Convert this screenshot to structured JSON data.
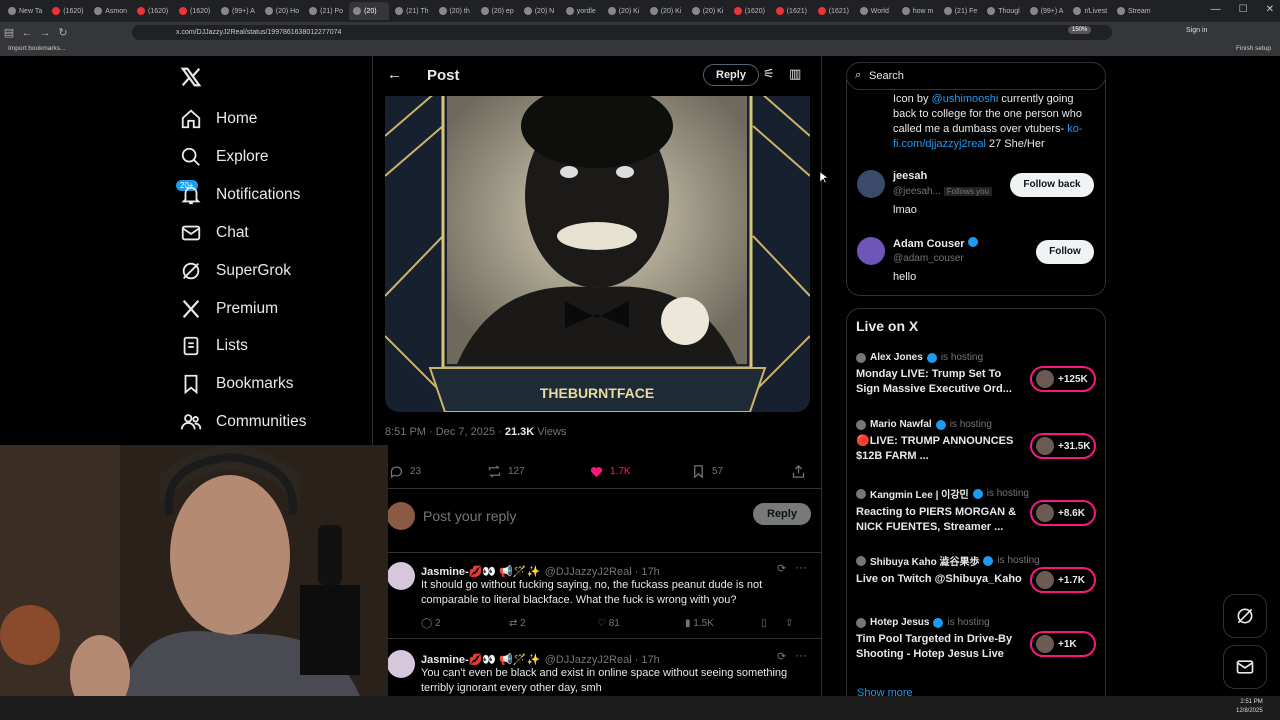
{
  "browser": {
    "tabs": [
      "New Ta",
      "(1620)",
      "Asmon",
      "(1620)",
      "(1620)",
      "(99+) A",
      "(20) Ho",
      "(21) Po",
      "(20)",
      "(21) Th",
      "(20) th",
      "(20) ep",
      "(20) N",
      "yordle",
      "(20) Ki",
      "(20) Ki",
      "(20) Ki",
      "(1620)",
      "(1621)",
      "(1621)",
      "World",
      "how m",
      "(21) Fe",
      "Thougl",
      "(99+) A",
      "r/Livest",
      "Stream"
    ],
    "url": "x.com/DJJazzyJ2Real/status/1997861638012277074",
    "zoom": "150%",
    "bookmarks_label": "Import bookmarks...",
    "sign_in": "Sign in",
    "finish_setup": "Finish setup"
  },
  "nav": {
    "items": [
      "Home",
      "Explore",
      "Notifications",
      "Chat",
      "SuperGrok",
      "Premium",
      "Lists",
      "Bookmarks",
      "Communities"
    ],
    "notif_badge": "20+"
  },
  "post": {
    "header_title": "Post",
    "reply_button": "Reply",
    "image_caption": "THEBURNTFACE",
    "time": "8:51 PM · Dec 7, 2025 ·",
    "views_count": "21.3K",
    "views_label": "Views",
    "replies": "23",
    "reposts": "127",
    "likes": "1.7K",
    "bookmarks": "57",
    "reply_placeholder": "Post your reply",
    "reply_submit": "Reply"
  },
  "replies": [
    {
      "name": "Jasmine-💋👀 📢🪄✨",
      "handle": "@DJJazzyJ2Real · 17h",
      "text": "It should go without fucking saying, no, the fuckass peanut dude is not comparable to literal blackface. What the fuck is wrong with you?",
      "comments": "2",
      "reposts": "2",
      "likes": "81",
      "views": "1.5K"
    },
    {
      "name": "Jasmine-💋👀 📢🪄✨",
      "handle": "@DJJazzyJ2Real · 17h",
      "text": "You can't even be black and exist in online space without seeing something terribly ignorant every other day, smh"
    }
  ],
  "right": {
    "search_placeholder": "Search",
    "bio_parts": [
      "Icon by ",
      "@ushimooshi",
      " currently going back to college for the one person who called me a dumbass over vtubers- ",
      "ko-fi.com/djjazzyj2real",
      " 27 She/Her"
    ],
    "users": [
      {
        "name": "jeesah",
        "handle": "@jeesah...",
        "follows_you": "Follows you",
        "bio": "lmao",
        "button": "Follow back"
      },
      {
        "name": "Adam Couser",
        "handle": "@adam_couser",
        "bio": "hello",
        "button": "Follow"
      }
    ],
    "live_title": "Live on X",
    "live": [
      {
        "host": "Alex Jones",
        "status": "is hosting",
        "title": "Monday LIVE: Trump Set To Sign Massive Executive Ord...",
        "count": "+125K"
      },
      {
        "host": "Mario Nawfal",
        "status": "is hosting",
        "title": "🔴LIVE: TRUMP ANNOUNCES $12B FARM ...",
        "count": "+31.5K"
      },
      {
        "host": "Kangmin Lee | 이강민",
        "status": "is hosting",
        "title": "Reacting to PIERS MORGAN & NICK FUENTES, Streamer ...",
        "count": "+8.6K"
      },
      {
        "host": "Shibuya Kaho 澁谷果歩",
        "status": "is hosting",
        "title": "Live on Twitch @Shibuya_Kaho",
        "count": "+1.7K"
      },
      {
        "host": "Hotep Jesus",
        "status": "is hosting",
        "title": "Tim Pool Targeted in Drive-By Shooting - Hotep Jesus Live",
        "count": "+1K"
      }
    ],
    "show_more": "Show more"
  },
  "taskbar": {
    "time": "2:51 PM",
    "date": "12/8/2025"
  },
  "colors": {
    "accent": "#1d9bf0",
    "like": "#f91880",
    "border": "#2f3336",
    "muted": "#71767b"
  }
}
